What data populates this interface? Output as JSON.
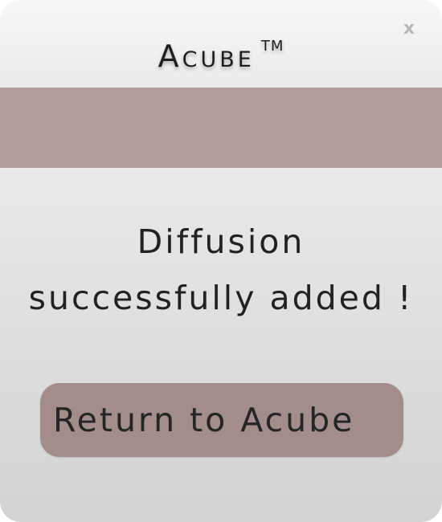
{
  "window": {
    "title": "Acube",
    "trademark": "TM",
    "close_label": "x"
  },
  "message": {
    "line1": "Diffusion",
    "line2": "successfully added !"
  },
  "actions": {
    "return_label": "Return to Acube"
  },
  "colors": {
    "banner": "#b39d9b",
    "button": "#a28d8a",
    "text": "#222222"
  }
}
